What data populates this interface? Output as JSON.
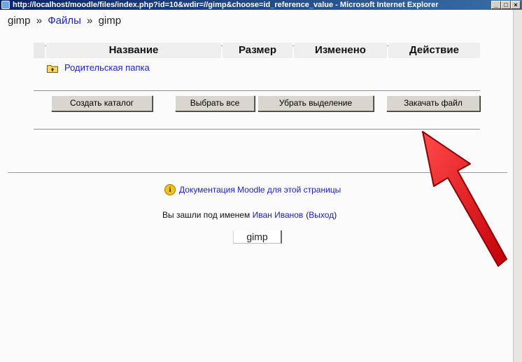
{
  "window": {
    "title": "http://localhost/moodle/files/index.php?id=10&wdir=//gimp&choose=id_reference_value - Microsoft Internet Explorer",
    "min_label": "_",
    "max_label": "□",
    "close_label": "×"
  },
  "breadcrumb": {
    "root": "gimp",
    "sep1": "»",
    "files": "Файлы",
    "sep2": "»",
    "current": "gimp"
  },
  "table": {
    "headers": {
      "name": "Название",
      "size": "Размер",
      "modified": "Изменено",
      "action": "Действие"
    },
    "parent_folder": "Родительская папка"
  },
  "buttons": {
    "mkdir": "Создать каталог",
    "select_all": "Выбрать все",
    "deselect": "Убрать выделение",
    "upload": "Закачать файл"
  },
  "footer": {
    "docs_link": "Документация Moodle для этой страницы",
    "logged_in_prefix": "Вы зашли под именем",
    "user_name": "Иван Иванов",
    "logout_open": "(",
    "logout_link": "Выход",
    "logout_close": ")",
    "course_tab": "gimp"
  },
  "colors": {
    "link": "#1a22c6",
    "annotation_arrow": "#e0141b"
  },
  "icons": {
    "parent_folder": "folder-up-icon",
    "docs": "info-icon",
    "annotation": "red-arrow"
  }
}
